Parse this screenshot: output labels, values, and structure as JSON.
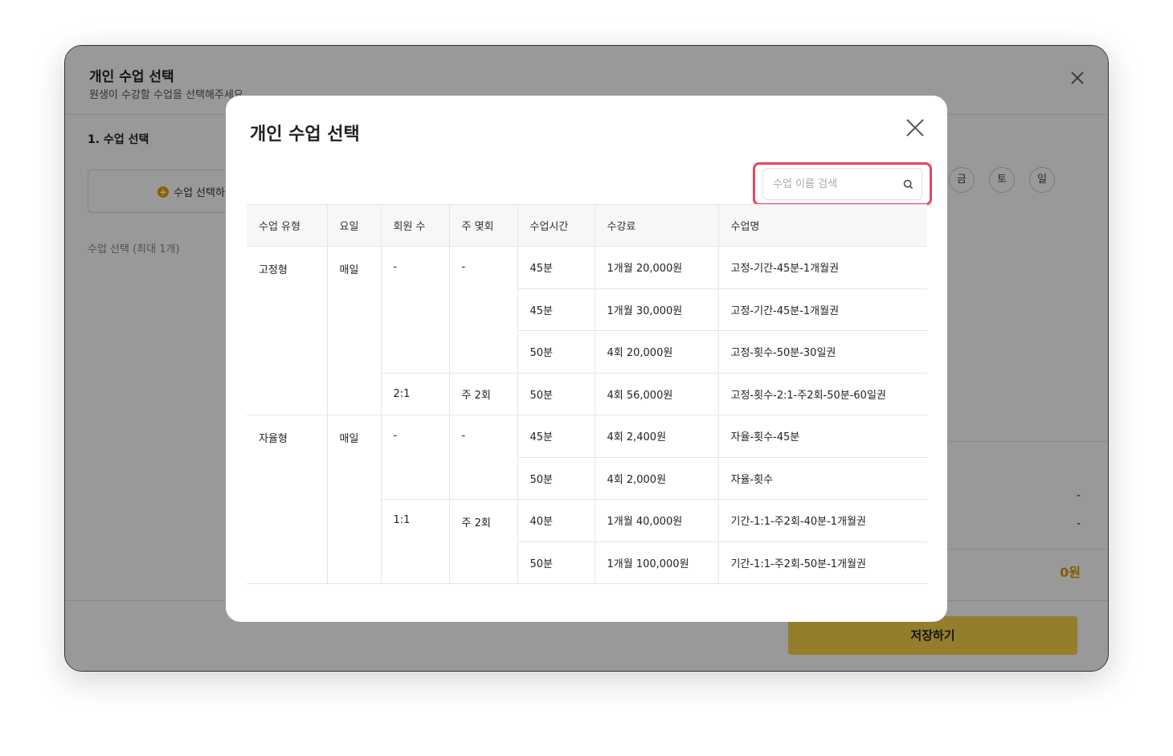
{
  "background": {
    "title": "개인 수업 선택",
    "subtitle": "원생이 수강할 수업을 선택해주세요.",
    "section_title": "1. 수업 선택",
    "add_button_label": "수업 선택하기",
    "select_limit_label": "수업 선택 (최대 1개)",
    "days": [
      "금",
      "토",
      "일"
    ],
    "summary_values": [
      "-",
      "-"
    ],
    "total": "0원",
    "save_label": "저장하기"
  },
  "modal": {
    "title": "개인 수업 선택",
    "search_placeholder": "수업 이름 검색",
    "columns": [
      "수업 유형",
      "요일",
      "회원 수",
      "주 몇회",
      "수업시간",
      "수강료",
      "수업명"
    ],
    "groups": [
      {
        "type": "고정형",
        "day": "매일",
        "subgroups": [
          {
            "members": "-",
            "per_week": "-",
            "rows": [
              {
                "time": "45분",
                "fee": "1개월 20,000원",
                "name": "고정-기간-45분-1개월권"
              },
              {
                "time": "45분",
                "fee": "1개월 30,000원",
                "name": "고정-기간-45분-1개월권"
              },
              {
                "time": "50분",
                "fee": "4회 20,000원",
                "name": "고정-횟수-50분-30일권"
              }
            ]
          },
          {
            "members": "2:1",
            "per_week": "주 2회",
            "rows": [
              {
                "time": "50분",
                "fee": "4회 56,000원",
                "name": "고정-횟수-2:1-주2회-50분-60일권"
              }
            ]
          }
        ]
      },
      {
        "type": "자율형",
        "day": "매일",
        "subgroups": [
          {
            "members": "-",
            "per_week": "-",
            "rows": [
              {
                "time": "45분",
                "fee": "4회 2,400원",
                "name": "자율-횟수-45분"
              },
              {
                "time": "50분",
                "fee": "4회 2,000원",
                "name": "자율-횟수"
              }
            ]
          },
          {
            "members": "1:1",
            "per_week": "주 2회",
            "rows": [
              {
                "time": "40분",
                "fee": "1개월 40,000원",
                "name": "기간-1:1-주2회-40분-1개월권"
              },
              {
                "time": "50분",
                "fee": "1개월 100,000원",
                "name": "기간-1:1-주2회-50분-1개월권"
              }
            ]
          }
        ]
      }
    ]
  },
  "colors": {
    "highlight": "#e8455f",
    "accent": "#e09a00",
    "save_button": "#f8d348"
  }
}
